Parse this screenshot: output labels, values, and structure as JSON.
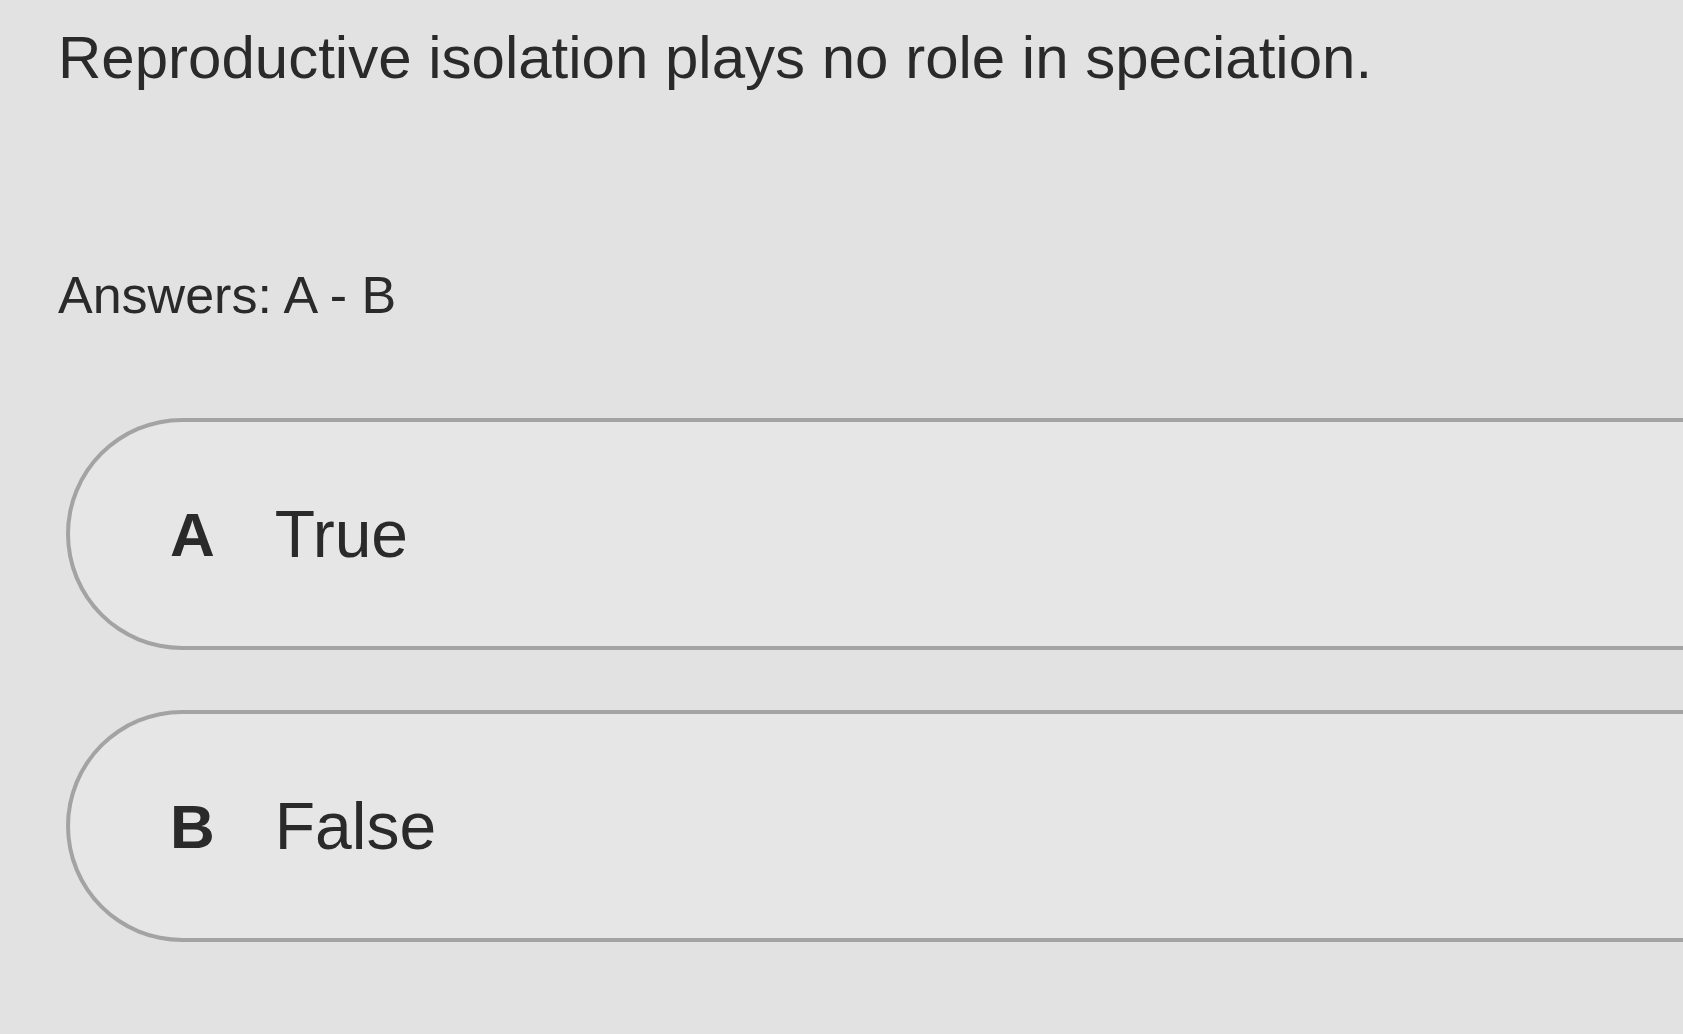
{
  "question": "Reproductive isolation plays no role in speciation.",
  "answers_label": "Answers: A - B",
  "options": [
    {
      "letter": "A",
      "text": "True"
    },
    {
      "letter": "B",
      "text": "False"
    }
  ]
}
